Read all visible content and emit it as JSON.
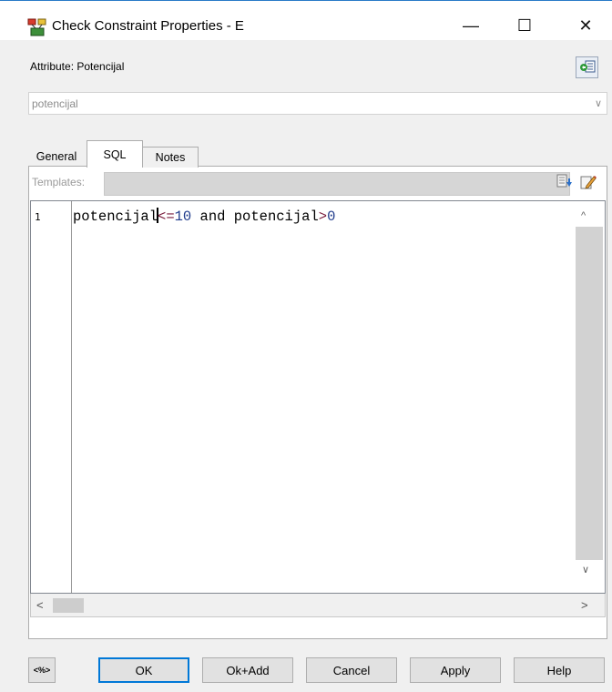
{
  "window": {
    "title": "Check Constraint Properties - E",
    "minimize_glyph": "—",
    "maximize_glyph": "☐",
    "close_glyph": "✕",
    "icon": "constraint-app-icon"
  },
  "header": {
    "attribute_label": "Attribute: Potencijal",
    "attribute_icon": "navigate-icon"
  },
  "attribute_combo": {
    "value": "potencijal",
    "chevron": "∨"
  },
  "tabs": [
    {
      "label": "General",
      "selected": false
    },
    {
      "label": "SQL",
      "selected": true
    },
    {
      "label": "Notes",
      "selected": false
    }
  ],
  "templates": {
    "label": "Templates:",
    "value": "",
    "chevron": "∨",
    "insert_icon": "insert-template-icon",
    "edit_icon": "edit-template-icon"
  },
  "editor": {
    "line_number": "1",
    "tokens": {
      "id1": "potencijal",
      "op1": "<=",
      "num1": "10",
      "and": " and potencijal",
      "op2": ">",
      "num2": "0"
    },
    "colors": {
      "operator": "#7a1c3c",
      "number": "#203c8c"
    }
  },
  "scrollbars": {
    "up": "^",
    "down": "∨",
    "left": "<",
    "right": ">"
  },
  "buttons": {
    "percent": "<%>",
    "ok": "OK",
    "ok_add": "Ok+Add",
    "cancel": "Cancel",
    "apply": "Apply",
    "help": "Help"
  },
  "colors": {
    "accent": "#0078d7",
    "title_border": "#2a7ac7"
  }
}
